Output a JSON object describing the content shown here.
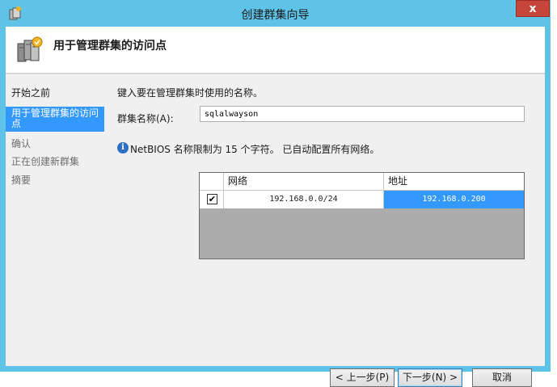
{
  "window": {
    "title": "创建群集向导",
    "close_label": "x"
  },
  "header": {
    "title": "用于管理群集的访问点"
  },
  "nav": {
    "items": [
      {
        "label": "开始之前"
      },
      {
        "label": "用于管理群集的访问点"
      },
      {
        "label": "确认"
      },
      {
        "label": "正在创建新群集"
      },
      {
        "label": "摘要"
      }
    ]
  },
  "content": {
    "instruction": "键入要在管理群集时使用的名称。",
    "cluster_name_label": "群集名称(A):",
    "cluster_name_value": "sqlalwayson",
    "info_text": "NetBIOS 名称限制为 15 个字符。 已自动配置所有网络。"
  },
  "network_grid": {
    "columns": [
      "网络",
      "地址"
    ],
    "rows": [
      {
        "checked": true,
        "check_mark": "✔",
        "network": "192.168.0.0/24",
        "address": "192.168.0.200"
      }
    ]
  },
  "buttons": {
    "prev": "< 上一步(P)",
    "next": "下一步(N) >",
    "cancel": "取消"
  },
  "colors": {
    "title_bar": "#5fc3e8",
    "selection": "#3399ff",
    "close": "#c7463c"
  }
}
